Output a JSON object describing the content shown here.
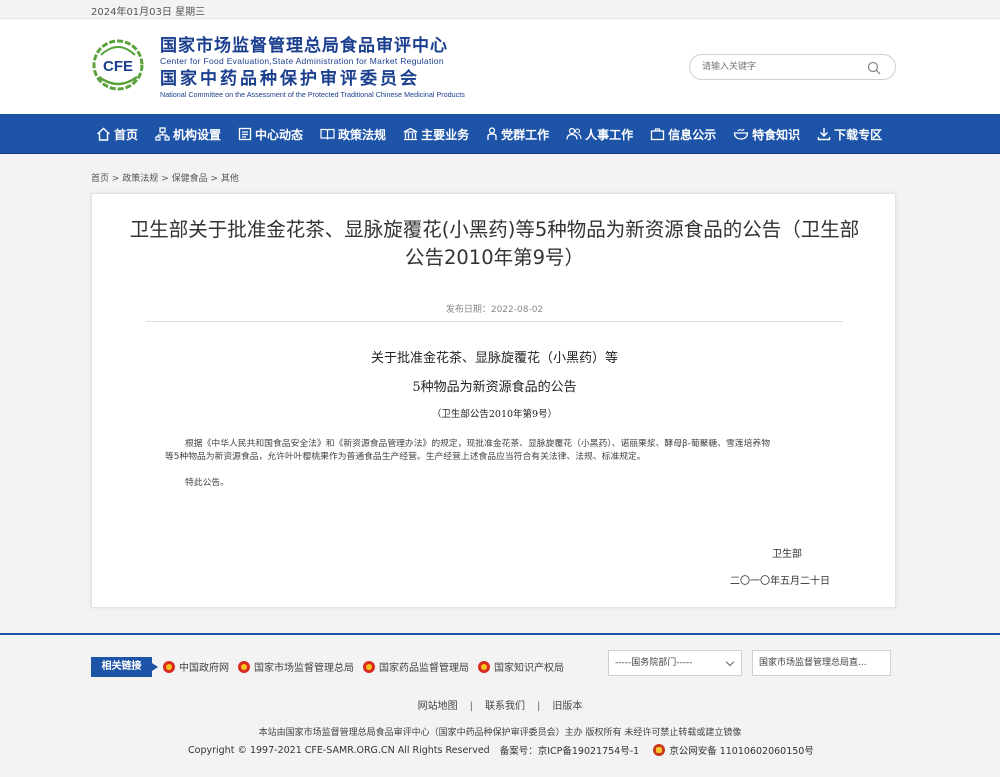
{
  "topbar": {
    "date": "2024年01月03日 星期三"
  },
  "header": {
    "logo_text": "CFE",
    "org_cn_1": "国家市场监督管理总局食品审评中心",
    "org_en_1": "Center for Food Evaluation,State Administration for Market Regulation",
    "org_cn_2": "国家中药品种保护审评委员会",
    "org_en_2": "National Committee on the Assessment of the Protected Traditional Chinese Medicinal Products",
    "search_placeholder": "请输入关键字",
    "brand_blue": "#1d54a8",
    "logo_green": "#5aa33c"
  },
  "nav": [
    {
      "label": "首页",
      "icon": "home-icon"
    },
    {
      "label": "机构设置",
      "icon": "org-chart-icon"
    },
    {
      "label": "中心动态",
      "icon": "news-icon"
    },
    {
      "label": "政策法规",
      "icon": "book-icon"
    },
    {
      "label": "主要业务",
      "icon": "building-icon"
    },
    {
      "label": "党群工作",
      "icon": "person-icon"
    },
    {
      "label": "人事工作",
      "icon": "people-icon"
    },
    {
      "label": "信息公示",
      "icon": "briefcase-icon"
    },
    {
      "label": "特食知识",
      "icon": "bowl-icon"
    },
    {
      "label": "下载专区",
      "icon": "download-icon"
    }
  ],
  "breadcrumb": [
    "首页",
    "政策法规",
    "保健食品",
    "其他"
  ],
  "article": {
    "title": "卫生部关于批准金花茶、显脉旋覆花(小黑药)等5种物品为新资源食品的公告（卫生部公告2010年第9号）",
    "publish_date": "发布日期：2022-08-02",
    "heading_1": "关于批准金花茶、显脉旋覆花（小黑药）等",
    "heading_2": "5种物品为新资源食品的公告",
    "heading_3": "（卫生部公告2010年第9号）",
    "para_1a": "根据《中华人民共和国食品安全法》和《新资源食品管理办法》的规定，现批准金花茶、显脉旋覆花（小黑药）、诺丽果浆、酵母β-葡聚糖、雪莲培养物",
    "para_1b": "等5种物品为新资源食品，允许叶叶樱桃果作为普通食品生产经营。生产经营上述食品应当符合有关法律、法规、标准规定。",
    "para_2": "特此公告。",
    "signature": "卫生部",
    "sign_date": "二〇一〇年五月二十日"
  },
  "footer": {
    "related_label": "相关链接",
    "links": [
      "中国政府网",
      "国家市场监督管理总局",
      "国家药品监督管理局",
      "国家知识产权局"
    ],
    "select_1": "-----国务院部门-----",
    "select_2": "国家市场监督管理总局直...",
    "bottom_links": [
      "网站地图",
      "联系我们",
      "旧版本"
    ],
    "copyright_1": "本站由国家市场监督管理总局食品审评中心（国家中药品种保护审评委员会）主办 版权所有 未经许可禁止转载或建立镜像",
    "copyright_2": "Copyright © 1997-2021 CFE-SAMR.ORG.CN All Rights Reserved",
    "icp": "备案号：京ICP备19021754号-1",
    "police_record": "京公网安备 11010602060150号"
  }
}
